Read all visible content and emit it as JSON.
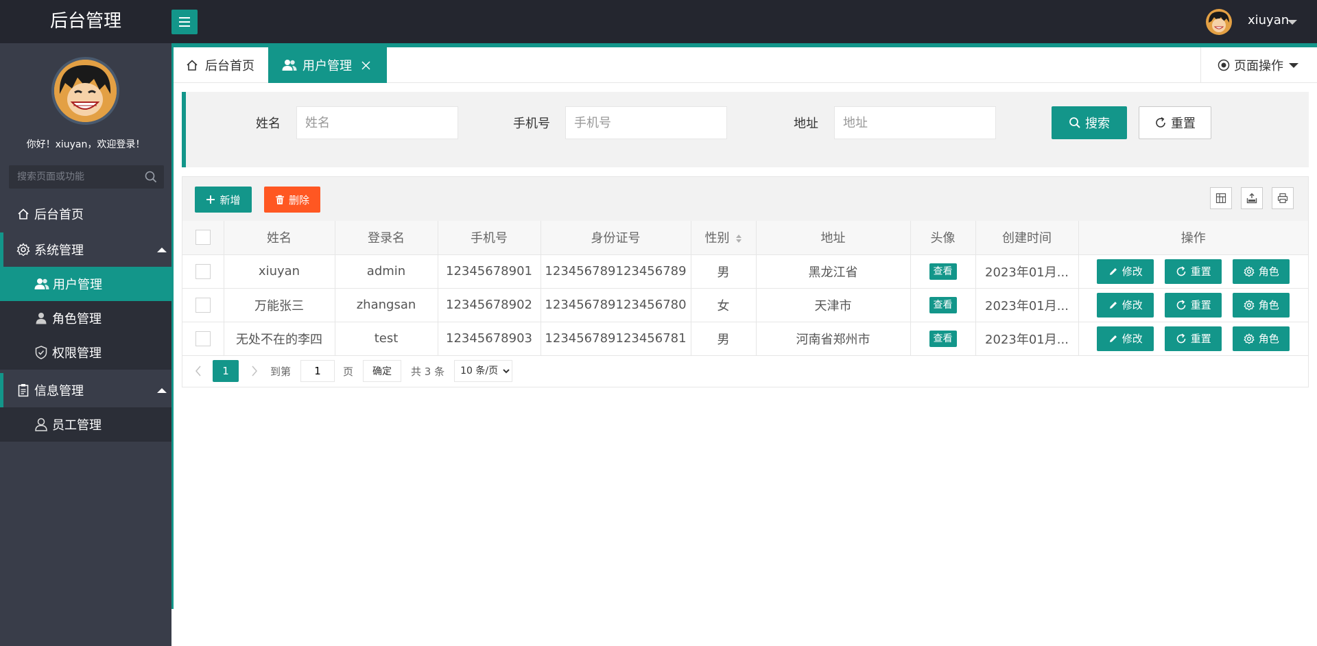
{
  "header": {
    "logo": "后台管理",
    "username": "xiuyan"
  },
  "sidebar": {
    "welcome": "你好！xiuyan，欢迎登录！",
    "search_placeholder": "搜索页面或功能",
    "home_label": "后台首页",
    "groups": [
      {
        "label": "系统管理",
        "items": [
          {
            "label": "用户管理",
            "active": true
          },
          {
            "label": "角色管理"
          },
          {
            "label": "权限管理"
          }
        ]
      },
      {
        "label": "信息管理",
        "items": [
          {
            "label": "员工管理"
          }
        ]
      }
    ]
  },
  "tabs": {
    "home": "后台首页",
    "current": "用户管理",
    "page_ops": "页面操作"
  },
  "search": {
    "name_label": "姓名",
    "name_placeholder": "姓名",
    "phone_label": "手机号",
    "phone_placeholder": "手机号",
    "address_label": "地址",
    "address_placeholder": "地址",
    "search_button": "搜索",
    "reset_button": "重置"
  },
  "toolbar": {
    "add": "新增",
    "delete": "删除"
  },
  "table": {
    "headers": [
      "姓名",
      "登录名",
      "手机号",
      "身份证号",
      "性别",
      "地址",
      "头像",
      "创建时间",
      "操作"
    ],
    "view_label": "查看",
    "actions": {
      "edit": "修改",
      "reset": "重置",
      "role": "角色"
    },
    "rows": [
      {
        "name": "xiuyan",
        "login": "admin",
        "phone": "12345678901",
        "id_card": "123456789123456789",
        "gender": "男",
        "address": "黑龙江省",
        "created": "2023年01月..."
      },
      {
        "name": "万能张三",
        "login": "zhangsan",
        "phone": "12345678902",
        "id_card": "123456789123456780",
        "gender": "女",
        "address": "天津市",
        "created": "2023年01月..."
      },
      {
        "name": "无处不在的李四",
        "login": "test",
        "phone": "12345678903",
        "id_card": "123456789123456781",
        "gender": "男",
        "address": "河南省郑州市",
        "created": "2023年01月..."
      }
    ]
  },
  "pagination": {
    "current": "1",
    "goto_label": "到第",
    "goto_value": "1",
    "page_label": "页",
    "confirm": "确定",
    "total": "共 3 条",
    "page_size": "10 条/页"
  },
  "colors": {
    "primary": "#13968a",
    "danger": "#ff5722",
    "sidebar": "#393d49",
    "topbar": "#24262f"
  }
}
